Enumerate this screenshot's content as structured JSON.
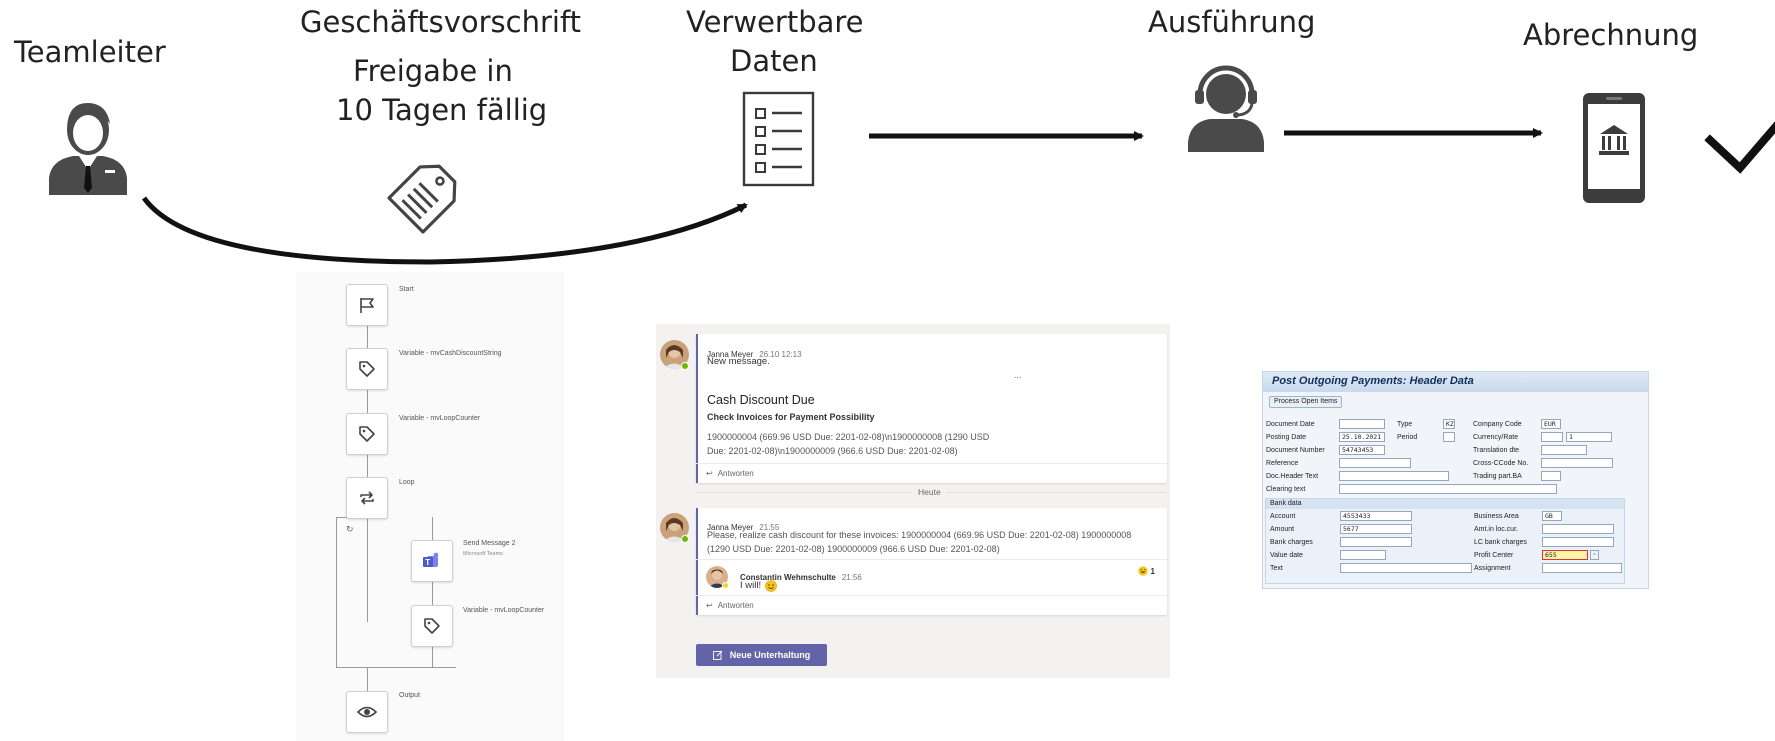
{
  "stages": {
    "teamleiter": "Teamleiter",
    "rule_title": "Geschäftsvorschrift",
    "rule_sub_1": "Freigabe in",
    "rule_sub_2": "10 Tagen fällig",
    "data_1": "Verwertbare",
    "data_2": "Daten",
    "execution": "Ausführung",
    "billing": "Abrechnung"
  },
  "icons": {
    "teamleiter": "business-person-icon",
    "rule": "price-tag-icon",
    "data": "checklist-icon",
    "execution": "headset-agent-icon",
    "billing": "mobile-bank-icon",
    "done": "check-mark-icon"
  },
  "colors": {
    "ink": "#222222",
    "teams_purple": "#6264a7",
    "sap_title": "#12305a",
    "presence_green": "#6bb700",
    "reaction_yellow": "#f5c419"
  },
  "workflow": {
    "start": "Start",
    "var1": "Variable - mvCashDiscountString",
    "var2": "Variable - mvLoopCounter",
    "loop": "Loop",
    "send": "Send Message 2",
    "send_sub": "Microsoft Teams",
    "var3": "Variable - mvLoopCounter",
    "output": "Output"
  },
  "chat": {
    "msg1": {
      "author": "Janna Meyer",
      "time": "26.10 12:13",
      "text": "New message.",
      "more": "...",
      "card_title": "Cash Discount Due",
      "card_subtitle": "Check Invoices for Payment Possibility",
      "card_body_1": "1900000004 (669.96 USD Due: 2201-02-08)\\n1900000008 (1290 USD",
      "card_body_2": "Due: 2201-02-08)\\n1900000009 (966.6 USD Due: 2201-02-08)",
      "reply": "Antworten"
    },
    "divider": "Heute",
    "msg2": {
      "author": "Janna Meyer",
      "time": "21:55",
      "text_1": "Please, realize cash discount for these invoices: 1900000004 (669.96 USD Due: 2201-02-08) 1900000008",
      "text_2": "(1290 USD Due: 2201-02-08) 1900000009 (966.6 USD Due: 2201-02-08)",
      "reply_author": "Constantin Wehmschulte",
      "reply_time": "21:56",
      "reply_text": "I will!",
      "reaction_count": "1",
      "reply": "Antworten"
    },
    "new_conversation": "Neue Unterhaltung"
  },
  "sap": {
    "title": "Post Outgoing Payments: Header Data",
    "button": "Process Open Items",
    "labels": {
      "doc_date": "Document Date",
      "type": "Type",
      "company_code": "Company Code",
      "posting_date": "Posting Date",
      "period": "Period",
      "currency_rate": "Currency/Rate",
      "doc_number": "Document Number",
      "translation_dte": "Translation dte",
      "reference": "Reference",
      "cross_ccode": "Cross-CCode No.",
      "doc_header_text": "Doc.Header Text",
      "trading_part": "Trading part.BA",
      "clearing_text": "Clearing text",
      "bank_data": "Bank data",
      "account": "Account",
      "business_area": "Business Area",
      "amount": "Amount",
      "amt_loc_cur": "Amt.in loc.cur.",
      "bank_charges": "Bank charges",
      "lc_bank_charges": "LC bank charges",
      "value_date": "Value date",
      "profit_center": "Profit Center",
      "text": "Text",
      "assignment": "Assignment"
    },
    "values": {
      "type": "KZ",
      "company_code": "EUR",
      "posting_date": "25.10.2021",
      "rate": "1",
      "doc_number": "54743453",
      "account": "4553433",
      "business_area": "GB",
      "amount": "5677",
      "profit_center": "655"
    }
  }
}
